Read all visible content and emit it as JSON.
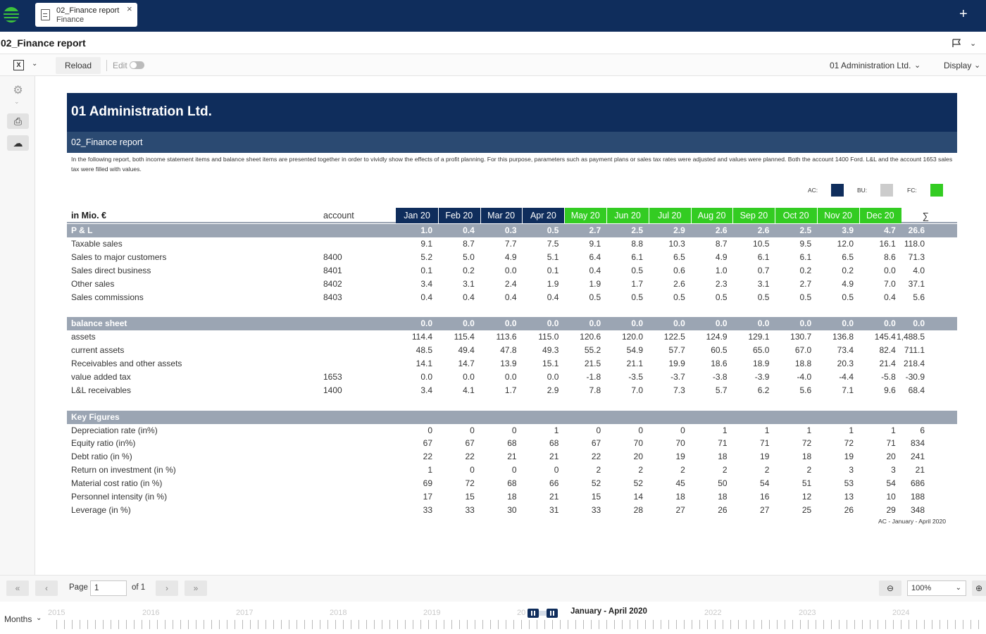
{
  "app": {
    "tab_title": "02_Finance report",
    "tab_subtitle": "Finance",
    "tab_close": "×",
    "new_tab": "+",
    "page_title": "02_Finance report"
  },
  "toolbar": {
    "excel_icon": "X",
    "reload_label": "Reload",
    "edit_label": "Edit",
    "edit_enabled": false,
    "company_selected": "01 Administration Ltd.",
    "display_label": "Display"
  },
  "report": {
    "company": "01 Administration Ltd.",
    "subtitle": "02_Finance report",
    "description": "In the following report, both income statement items and balance sheet items are presented together in order to vividly show the effects of a profit planning. For this purpose, parameters such as payment plans or sales tax rates were adjusted and values were planned. Both the account 1400 Ford. L&L and the account 1653 sales tax were filled with values.",
    "legend": [
      {
        "label": "AC:",
        "color": "#0f2d5c"
      },
      {
        "label": "BU:",
        "color": "#cccccc"
      },
      {
        "label": "FC:",
        "color": "#33cc22"
      }
    ],
    "unit_label": "in Mio. €",
    "account_label": "account",
    "sum_label": "∑",
    "months": [
      {
        "label": "Jan 20",
        "type": "AC"
      },
      {
        "label": "Feb 20",
        "type": "AC"
      },
      {
        "label": "Mar 20",
        "type": "AC"
      },
      {
        "label": "Apr 20",
        "type": "AC"
      },
      {
        "label": "May 20",
        "type": "FC"
      },
      {
        "label": "Jun 20",
        "type": "FC"
      },
      {
        "label": "Jul 20",
        "type": "FC"
      },
      {
        "label": "Aug 20",
        "type": "FC"
      },
      {
        "label": "Sep 20",
        "type": "FC"
      },
      {
        "label": "Oct 20",
        "type": "FC"
      },
      {
        "label": "Nov 20",
        "type": "FC"
      },
      {
        "label": "Dec 20",
        "type": "FC"
      }
    ],
    "sections": [
      {
        "title": "P & L",
        "values": [
          "1.0",
          "0.4",
          "0.3",
          "0.5",
          "2.7",
          "2.5",
          "2.9",
          "2.6",
          "2.6",
          "2.5",
          "3.9",
          "4.7"
        ],
        "sum": "26.6",
        "rows": [
          {
            "label": "Taxable sales",
            "account": "",
            "values": [
              "9.1",
              "8.7",
              "7.7",
              "7.5",
              "9.1",
              "8.8",
              "10.3",
              "8.7",
              "10.5",
              "9.5",
              "12.0",
              "16.1"
            ],
            "sum": "118.0"
          },
          {
            "label": "Sales to major customers",
            "account": "8400",
            "values": [
              "5.2",
              "5.0",
              "4.9",
              "5.1",
              "6.4",
              "6.1",
              "6.5",
              "4.9",
              "6.1",
              "6.1",
              "6.5",
              "8.6"
            ],
            "sum": "71.3"
          },
          {
            "label": "Sales direct business",
            "account": "8401",
            "values": [
              "0.1",
              "0.2",
              "0.0",
              "0.1",
              "0.4",
              "0.5",
              "0.6",
              "1.0",
              "0.7",
              "0.2",
              "0.2",
              "0.0"
            ],
            "sum": "4.0"
          },
          {
            "label": "Other sales",
            "account": "8402",
            "values": [
              "3.4",
              "3.1",
              "2.4",
              "1.9",
              "1.9",
              "1.7",
              "2.6",
              "2.3",
              "3.1",
              "2.7",
              "4.9",
              "7.0"
            ],
            "sum": "37.1"
          },
          {
            "label": "Sales commissions",
            "account": "8403",
            "values": [
              "0.4",
              "0.4",
              "0.4",
              "0.4",
              "0.5",
              "0.5",
              "0.5",
              "0.5",
              "0.5",
              "0.5",
              "0.5",
              "0.4"
            ],
            "sum": "5.6"
          }
        ]
      },
      {
        "title": "balance sheet",
        "values": [
          "0.0",
          "0.0",
          "0.0",
          "0.0",
          "0.0",
          "0.0",
          "0.0",
          "0.0",
          "0.0",
          "0.0",
          "0.0",
          "0.0"
        ],
        "sum": "0.0",
        "rows": [
          {
            "label": "assets",
            "account": "",
            "values": [
              "114.4",
              "115.4",
              "113.6",
              "115.0",
              "120.6",
              "120.0",
              "122.5",
              "124.9",
              "129.1",
              "130.7",
              "136.8",
              "145.4"
            ],
            "sum": "1,488.5"
          },
          {
            "label": "current assets",
            "account": "",
            "values": [
              "48.5",
              "49.4",
              "47.8",
              "49.3",
              "55.2",
              "54.9",
              "57.7",
              "60.5",
              "65.0",
              "67.0",
              "73.4",
              "82.4"
            ],
            "sum": "711.1"
          },
          {
            "label": "Receivables and other assets",
            "account": "",
            "values": [
              "14.1",
              "14.7",
              "13.9",
              "15.1",
              "21.5",
              "21.1",
              "19.9",
              "18.6",
              "18.9",
              "18.8",
              "20.3",
              "21.4"
            ],
            "sum": "218.4"
          },
          {
            "label": "value added tax",
            "account": "1653",
            "values": [
              "0.0",
              "0.0",
              "0.0",
              "0.0",
              "-1.8",
              "-3.5",
              "-3.7",
              "-3.8",
              "-3.9",
              "-4.0",
              "-4.4",
              "-5.8"
            ],
            "sum": "-30.9"
          },
          {
            "label": "L&L receivables",
            "account": "1400",
            "values": [
              "3.4",
              "4.1",
              "1.7",
              "2.9",
              "7.8",
              "7.0",
              "7.3",
              "5.7",
              "6.2",
              "5.6",
              "7.1",
              "9.6"
            ],
            "sum": "68.4"
          }
        ]
      },
      {
        "title": "Key Figures",
        "values": [
          "",
          "",
          "",
          "",
          "",
          "",
          "",
          "",
          "",
          "",
          "",
          ""
        ],
        "sum": "",
        "rows": [
          {
            "label": "Depreciation rate (in%)",
            "account": "",
            "values": [
              "0",
              "0",
              "0",
              "1",
              "0",
              "0",
              "0",
              "1",
              "1",
              "1",
              "1",
              "1"
            ],
            "sum": "6"
          },
          {
            "label": "Equity ratio (in%)",
            "account": "",
            "values": [
              "67",
              "67",
              "68",
              "68",
              "67",
              "70",
              "70",
              "71",
              "71",
              "72",
              "72",
              "71"
            ],
            "sum": "834"
          },
          {
            "label": "Debt ratio (in %)",
            "account": "",
            "values": [
              "22",
              "22",
              "21",
              "21",
              "22",
              "20",
              "19",
              "18",
              "19",
              "18",
              "19",
              "20"
            ],
            "sum": "241"
          },
          {
            "label": "Return on investment (in %)",
            "account": "",
            "values": [
              "1",
              "0",
              "0",
              "0",
              "2",
              "2",
              "2",
              "2",
              "2",
              "2",
              "3",
              "3"
            ],
            "sum": "21"
          },
          {
            "label": "Material cost ratio (in %)",
            "account": "",
            "values": [
              "69",
              "72",
              "68",
              "66",
              "52",
              "52",
              "45",
              "50",
              "54",
              "51",
              "53",
              "54"
            ],
            "sum": "686"
          },
          {
            "label": "Personnel intensity (in %)",
            "account": "",
            "values": [
              "17",
              "15",
              "18",
              "21",
              "15",
              "14",
              "18",
              "18",
              "16",
              "12",
              "13",
              "10"
            ],
            "sum": "188"
          },
          {
            "label": "Leverage (in %)",
            "account": "",
            "values": [
              "33",
              "33",
              "30",
              "31",
              "33",
              "28",
              "27",
              "26",
              "27",
              "25",
              "26",
              "29"
            ],
            "sum": "348"
          }
        ]
      }
    ],
    "footnote": "AC - January - April 2020"
  },
  "pager": {
    "page_label": "Page",
    "page_value": "1",
    "of_label": "of 1",
    "zoom": "100%"
  },
  "timeline": {
    "granularity": "Months",
    "years": [
      "2015",
      "2016",
      "2017",
      "2018",
      "2019",
      "20",
      "2022",
      "2023",
      "2024"
    ],
    "range_label": "January - April 2020"
  }
}
